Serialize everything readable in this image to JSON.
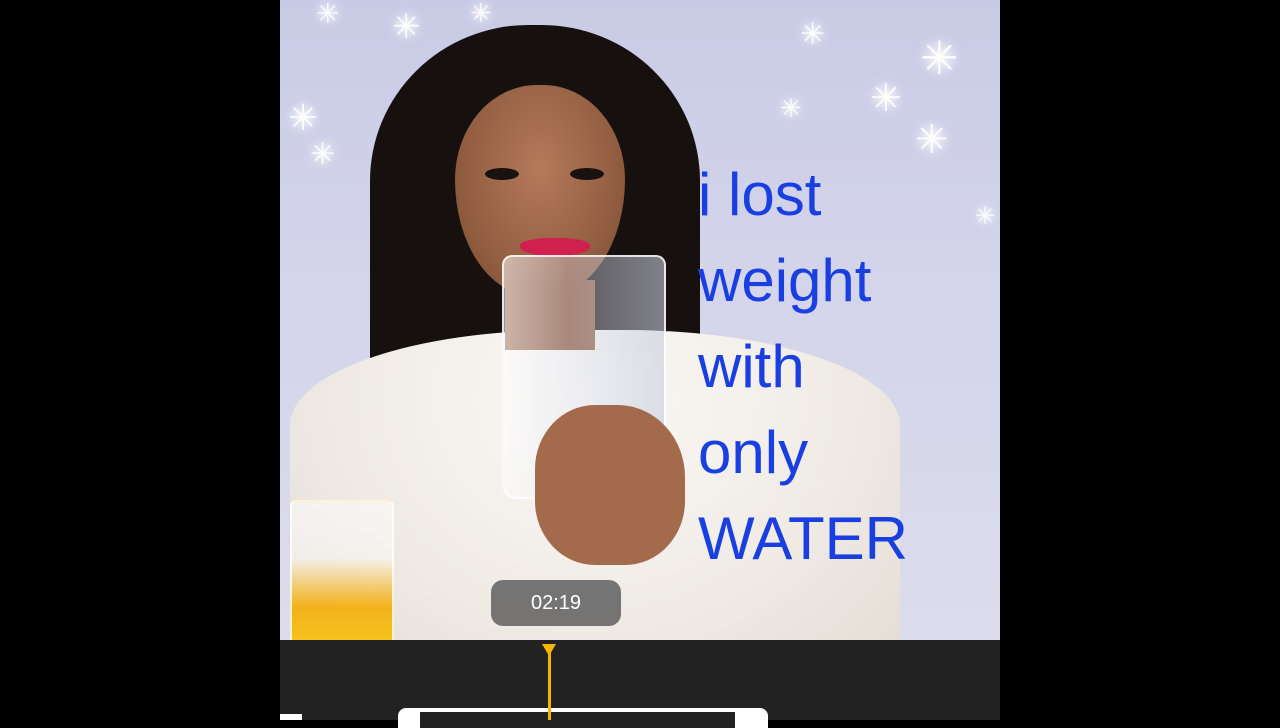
{
  "video": {
    "overlay_lines": [
      "i lost",
      "weight",
      "with",
      "only",
      "WATER"
    ],
    "timestamp": "02:19"
  },
  "colors": {
    "overlay_text": "#1a3fe0",
    "playhead": "#f4b400",
    "timeline_bg": "#222222",
    "badge_bg": "#5f5f5f"
  },
  "icons": {
    "playhead": "triangle-down-marker",
    "sparkles": "snowflake-star"
  }
}
